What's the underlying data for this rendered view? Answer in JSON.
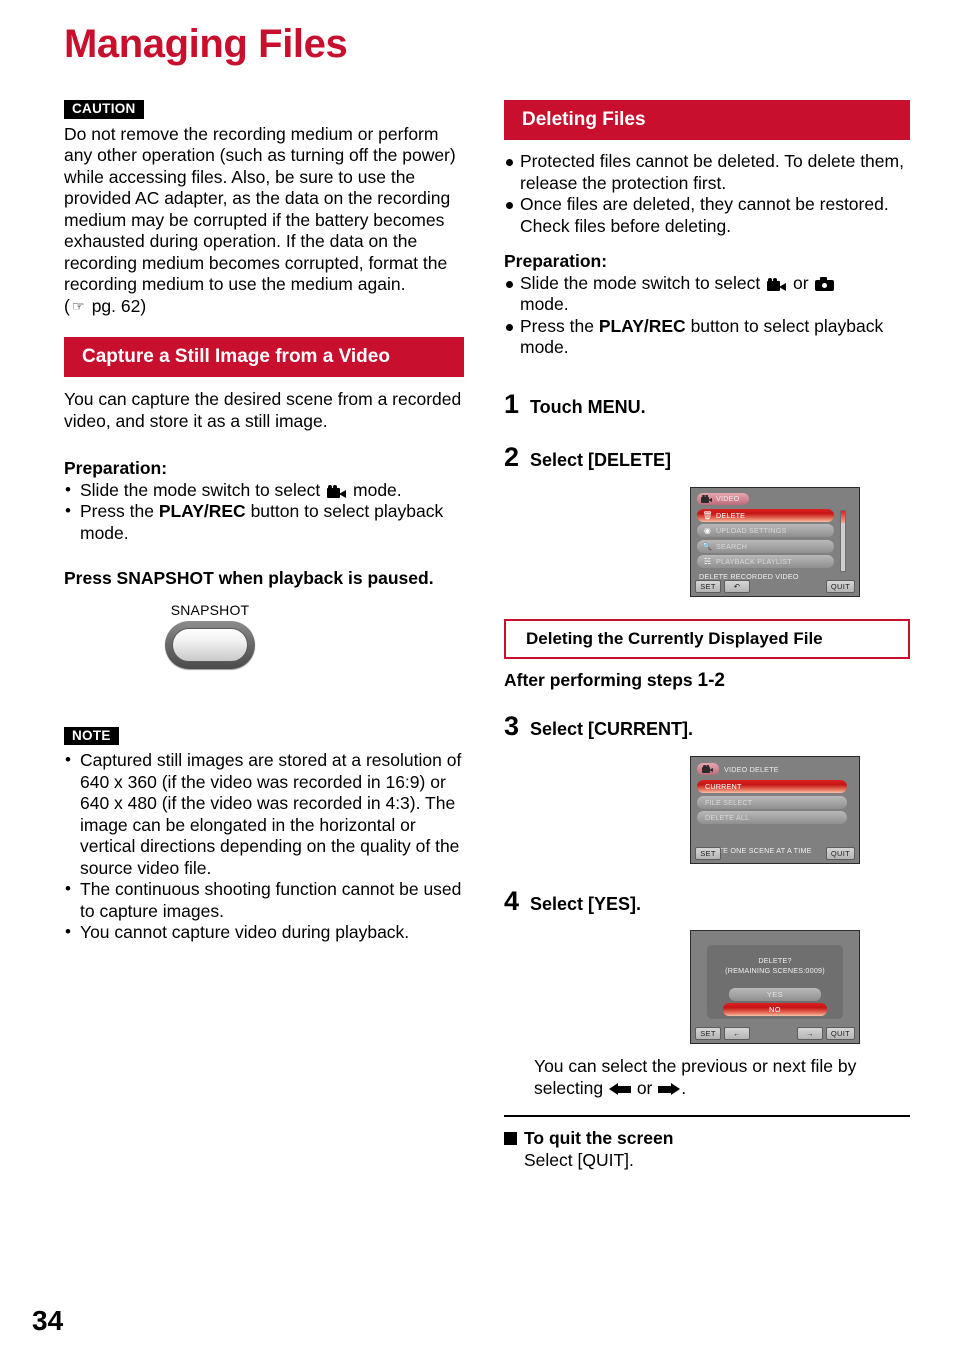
{
  "page": {
    "title": "Managing Files",
    "number": "34",
    "accent_red": "#C8102E"
  },
  "left_column": {
    "caution": {
      "tag": "CAUTION",
      "text": "Do not remove the recording medium or perform any other operation (such as turning off the power) while accessing files. Also, be sure to use the provided AC adapter, as the data on the recording medium may be corrupted if the battery becomes exhausted during operation. If the data on the recording medium becomes corrupted, format the recording medium to use the medium again.",
      "ref_prefix": "(",
      "ref_text": "pg. 62)"
    },
    "capture_section": {
      "heading": "Capture a Still Image from a Video",
      "intro": "You can capture the desired scene from a recorded video, and store it as a still image.",
      "preparation_label": "Preparation:",
      "prep_1_a": "Slide the mode switch to select",
      "prep_1_b": "mode.",
      "prep_2_a": "Press the",
      "prep_2_bold": "PLAY/REC",
      "prep_2_b": "button to select playback mode.",
      "instruction": "Press SNAPSHOT when playback is paused.",
      "snapshot_label": "SNAPSHOT"
    },
    "note": {
      "tag": "NOTE",
      "items": [
        "Captured still images are stored at a resolution of 640 x 360 (if the video was recorded in 16:9) or 640 x 480 (if the video was recorded in 4:3). The image can be elongated in the horizontal or vertical directions depending on the quality of the source video file.",
        "The continuous shooting function cannot be used to capture images.",
        "You cannot capture video during playback."
      ]
    }
  },
  "right_column": {
    "deleting_section": {
      "heading": "Deleting Files",
      "bullets": [
        "Protected files cannot be deleted. To delete them, release the protection first.",
        "Once files are deleted, they cannot be restored. Check files before deleting."
      ],
      "preparation_label": "Preparation:",
      "prep_1_a": "Slide the mode switch to select",
      "prep_1_or": "or",
      "prep_1_b": "mode.",
      "prep_2_a": "Press the",
      "prep_2_bold": "PLAY/REC",
      "prep_2_b": "button to select playback mode."
    },
    "steps": [
      {
        "num": "1",
        "text": "Touch MENU."
      },
      {
        "num": "2",
        "text": "Select [DELETE]"
      },
      {
        "num": "3",
        "text": "Select [CURRENT]."
      },
      {
        "num": "4",
        "text": "Select [YES]."
      }
    ],
    "subheading": {
      "title": "Deleting the Currently Displayed File",
      "after_steps_a": "After performing steps",
      "after_steps_b": "1-2"
    },
    "after_note": {
      "line": "You can select the previous or next file by selecting",
      "or_word": "or",
      "tail": "."
    },
    "quit_section": {
      "heading": "To quit the screen",
      "text": "Select [QUIT]."
    }
  },
  "lcd_screens": {
    "menu": {
      "tab_title": "VIDEO",
      "items": [
        {
          "label": "DELETE",
          "icon": "trash-icon",
          "selected": true
        },
        {
          "label": "UPLOAD SETTINGS",
          "icon": "upload-icon",
          "selected": false
        },
        {
          "label": "SEARCH",
          "icon": "search-icon",
          "selected": false
        },
        {
          "label": "PLAYBACK PLAYLIST",
          "icon": "playlist-icon",
          "selected": false
        }
      ],
      "description": "DELETE RECORDED VIDEO",
      "keys": {
        "set": "SET",
        "back": "↶",
        "quit": "QUIT"
      }
    },
    "video_delete": {
      "tab_title": "VIDEO DELETE",
      "items": [
        {
          "label": "CURRENT",
          "selected": true
        },
        {
          "label": "FILE SELECT",
          "selected": false
        },
        {
          "label": "DELETE ALL",
          "selected": false
        }
      ],
      "description": "DELETE ONE SCENE AT A TIME",
      "keys": {
        "set": "SET",
        "quit": "QUIT"
      }
    },
    "confirm": {
      "title": "DELETE?",
      "subtitle": "(REMAINING SCENES:0009)",
      "yes": "YES",
      "no": "NO",
      "keys": {
        "set": "SET",
        "prev": "←",
        "next": "→",
        "quit": "QUIT"
      }
    }
  }
}
